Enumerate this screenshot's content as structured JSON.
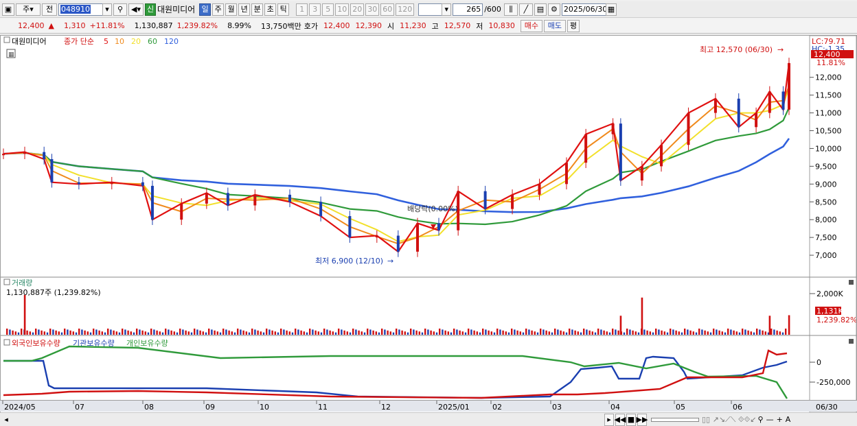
{
  "toolbar": {
    "period_main": "주",
    "period_prev": "전",
    "stock_code": "048910",
    "new_badge": "신",
    "stock_name": "대원미디어",
    "periods": [
      {
        "label": "일",
        "active": true
      },
      {
        "label": "주",
        "active": false
      },
      {
        "label": "월",
        "active": false
      },
      {
        "label": "년",
        "active": false
      },
      {
        "label": "분",
        "active": false
      },
      {
        "label": "초",
        "active": false
      },
      {
        "label": "틱",
        "active": false
      }
    ],
    "intervals": [
      "1",
      "3",
      "5",
      "10",
      "20",
      "30",
      "60",
      "120"
    ],
    "count": "265",
    "count_max": "/600",
    "date": "2025/06/30"
  },
  "quote": {
    "price": "12,400",
    "change": "1,310",
    "change_pct": "+11.81%",
    "volume": "1,130,887",
    "volume_pct": "1,239.82%",
    "turnover": "8.99%",
    "amount": "13,750백만",
    "ask_label": "호가",
    "ask": "12,400",
    "bid": "12,390",
    "open_label": "시",
    "open": "11,230",
    "high_label": "고",
    "high": "12,570",
    "low_label": "저",
    "low": "10,830",
    "buy_button": "매수",
    "sell_button": "매도",
    "eval_button": "평"
  },
  "colors": {
    "up": "#d01010",
    "down": "#1a3fb0",
    "ma5": "#e01010",
    "ma10": "#f08a1c",
    "ma20": "#f2e02a",
    "ma60": "#2f9a3a",
    "ma120": "#3060dd"
  },
  "chart_data": [
    {
      "type": "candlestick",
      "title": "대원미디어",
      "legend": {
        "prefix": "종가 단순",
        "periods": [
          "5",
          "10",
          "20",
          "60",
          "120"
        ]
      },
      "y_ticks": [
        "12,000",
        "11,500",
        "11,000",
        "10,500",
        "10,000",
        "9,500",
        "9,000",
        "8,500",
        "8,000",
        "7,500",
        "7,000"
      ],
      "ylim": [
        6500,
        12900
      ],
      "right_labels": {
        "lc": "LC:79.71",
        "hc": "HC:-1.35",
        "last_price": "12,400",
        "last_change": "11.81%"
      },
      "annotations": {
        "high": "최고 12,570 (06/30)",
        "low": "최저 6,900 (12/10)",
        "dividend": "배당락(0.00%)"
      },
      "close_series": [
        {
          "date": "2024/05/20",
          "value": 9850
        },
        {
          "date": "2024/05/31",
          "value": 9900
        },
        {
          "date": "2024/06/10",
          "value": 9700
        },
        {
          "date": "2024/06/14",
          "value": 9050
        },
        {
          "date": "2024/06/28",
          "value": 9000
        },
        {
          "date": "2024/07/15",
          "value": 9050
        },
        {
          "date": "2024/07/31",
          "value": 8950
        },
        {
          "date": "2024/08/05",
          "value": 8000
        },
        {
          "date": "2024/08/20",
          "value": 8450
        },
        {
          "date": "2024/09/02",
          "value": 8750
        },
        {
          "date": "2024/09/13",
          "value": 8400
        },
        {
          "date": "2024/09/27",
          "value": 8700
        },
        {
          "date": "2024/10/15",
          "value": 8500
        },
        {
          "date": "2024/10/31",
          "value": 8100
        },
        {
          "date": "2024/11/15",
          "value": 7500
        },
        {
          "date": "2024/11/29",
          "value": 7550
        },
        {
          "date": "2024/12/10",
          "value": 7100
        },
        {
          "date": "2024/12/20",
          "value": 7900
        },
        {
          "date": "2024/12/31",
          "value": 7700
        },
        {
          "date": "2025/01/10",
          "value": 8800
        },
        {
          "date": "2025/01/24",
          "value": 8300
        },
        {
          "date": "2025/02/07",
          "value": 8700
        },
        {
          "date": "2025/02/21",
          "value": 9000
        },
        {
          "date": "2025/03/07",
          "value": 9600
        },
        {
          "date": "2025/03/17",
          "value": 10400
        },
        {
          "date": "2025/03/31",
          "value": 10700
        },
        {
          "date": "2025/04/04",
          "value": 9100
        },
        {
          "date": "2025/04/15",
          "value": 9500
        },
        {
          "date": "2025/04/25",
          "value": 10100
        },
        {
          "date": "2025/05/09",
          "value": 11000
        },
        {
          "date": "2025/05/23",
          "value": 11400
        },
        {
          "date": "2025/06/04",
          "value": 10600
        },
        {
          "date": "2025/06/13",
          "value": 11000
        },
        {
          "date": "2025/06/20",
          "value": 11600
        },
        {
          "date": "2025/06/27",
          "value": 11090
        },
        {
          "date": "2025/06/30",
          "value": 12400
        }
      ]
    },
    {
      "type": "bar",
      "title": "거래량",
      "current_label": "1,130,887주 (1,239.82%)",
      "y_ticks": [
        "2,000K"
      ],
      "right_labels": {
        "last": "1,131K",
        "pct": "1,239.82%"
      },
      "spikes": [
        {
          "date": "2024/05/31",
          "value": 2300
        },
        {
          "date": "2025/04/04",
          "value": 1100
        },
        {
          "date": "2025/04/15",
          "value": 2150
        },
        {
          "date": "2025/06/20",
          "value": 1100
        },
        {
          "date": "2025/06/30",
          "value": 1131
        }
      ]
    },
    {
      "type": "line",
      "series": [
        {
          "name": "외국인보유수량"
        },
        {
          "name": "기관보유수량"
        },
        {
          "name": "개인보유수량"
        }
      ],
      "y_ticks": [
        "0",
        "-250,000"
      ]
    }
  ],
  "time_axis": [
    "2024/05",
    "07",
    "08",
    "09",
    "10",
    "11",
    "12",
    "2025/01",
    "02",
    "03",
    "04",
    "05",
    "06",
    "06/30"
  ]
}
